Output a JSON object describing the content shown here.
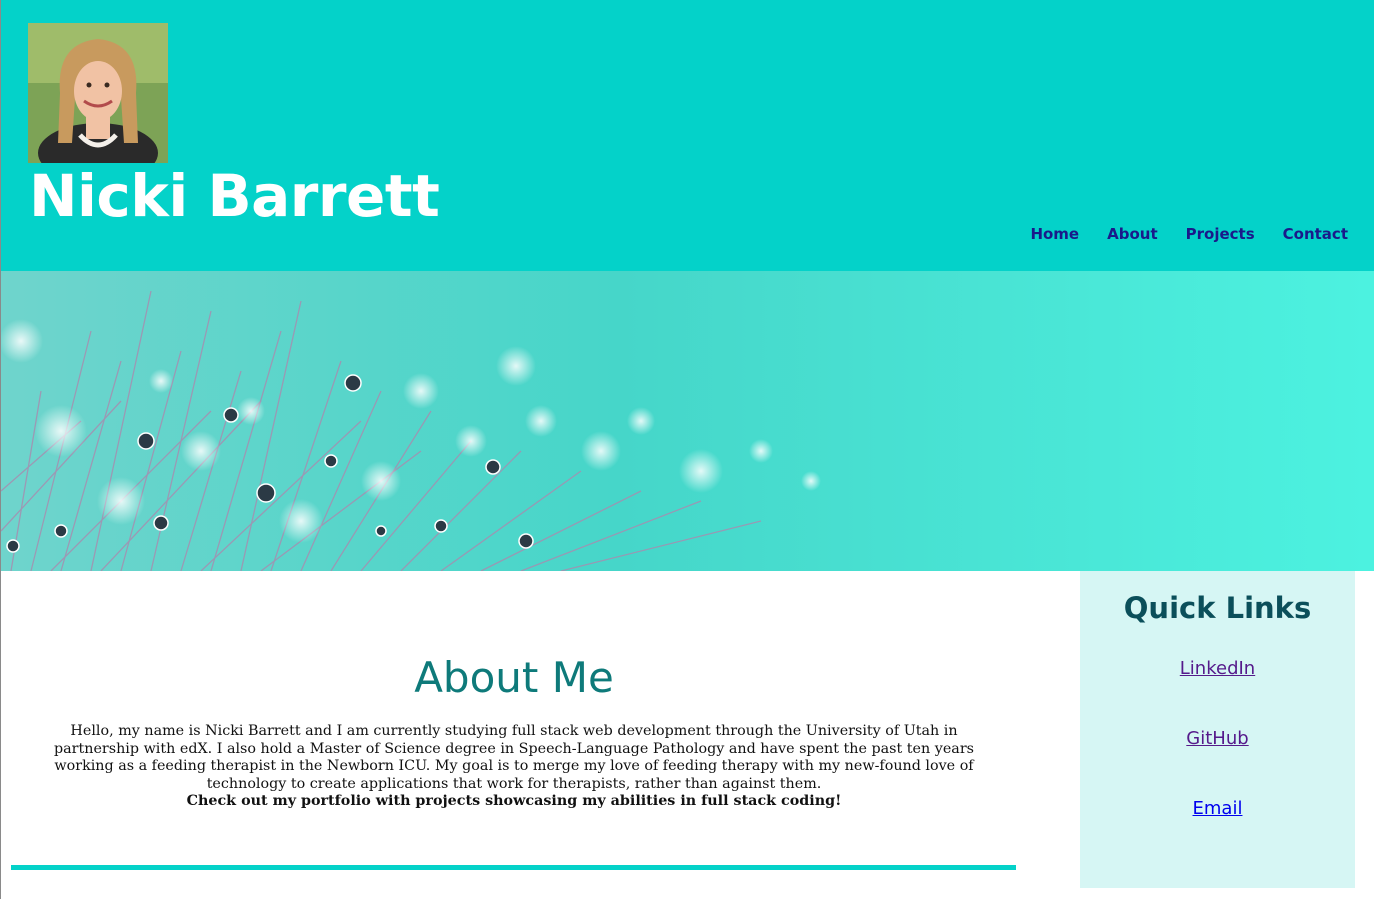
{
  "header": {
    "name": "Nicki Barrett",
    "nav": [
      "Home",
      "About",
      "Projects",
      "Contact"
    ]
  },
  "colors": {
    "header_bg": "#04d2c9",
    "nav_text": "#1a1a8a",
    "heading_teal": "#0e7a7a",
    "aside_bg": "#d6f6f4",
    "aside_heading": "#0b4f5a"
  },
  "about": {
    "heading": "About Me",
    "body": "Hello, my name is Nicki Barrett and I am currently studying full stack web development through the University of Utah in partnership with edX. I also hold a Master of Science degree in Speech-Language Pathology and have spent the past ten years working as a feeding therapist in the Newborn ICU. My goal is to merge my love of feeding therapy with my new-found love of technology to create applications that work for therapists, rather than against them.",
    "cta": "Check out my portfolio with projects showcasing my abilities in full stack coding!"
  },
  "quick_links": {
    "heading": "Quick Links",
    "links": [
      "LinkedIn",
      "GitHub",
      "Email"
    ]
  }
}
